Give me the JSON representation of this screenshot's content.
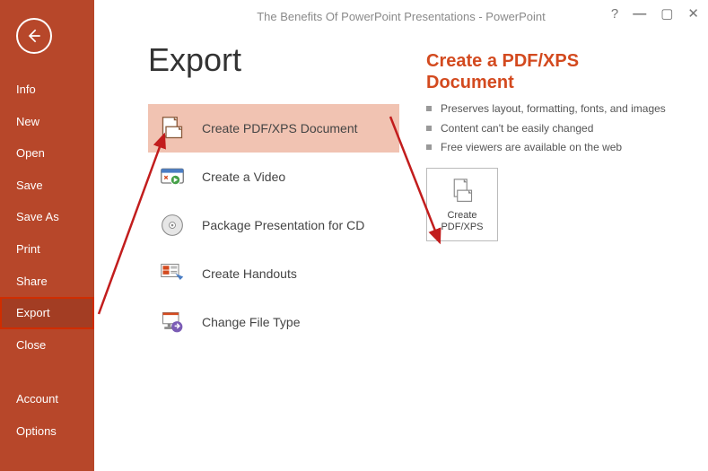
{
  "titlebar": {
    "text": "The Benefits Of PowerPoint Presentations - PowerPoint"
  },
  "sidebar": {
    "items": [
      {
        "label": "Info"
      },
      {
        "label": "New"
      },
      {
        "label": "Open"
      },
      {
        "label": "Save"
      },
      {
        "label": "Save As"
      },
      {
        "label": "Print"
      },
      {
        "label": "Share"
      },
      {
        "label": "Export"
      },
      {
        "label": "Close"
      }
    ],
    "footer": [
      {
        "label": "Account"
      },
      {
        "label": "Options"
      }
    ]
  },
  "page": {
    "title": "Export",
    "options": [
      {
        "label": "Create PDF/XPS Document"
      },
      {
        "label": "Create a Video"
      },
      {
        "label": "Package Presentation for CD"
      },
      {
        "label": "Create Handouts"
      },
      {
        "label": "Change File Type"
      }
    ],
    "detail": {
      "title": "Create a PDF/XPS Document",
      "bullets": [
        "Preserves layout, formatting, fonts, and images",
        "Content can't be easily changed",
        "Free viewers are available on the web"
      ],
      "button": "Create PDF/XPS"
    }
  }
}
